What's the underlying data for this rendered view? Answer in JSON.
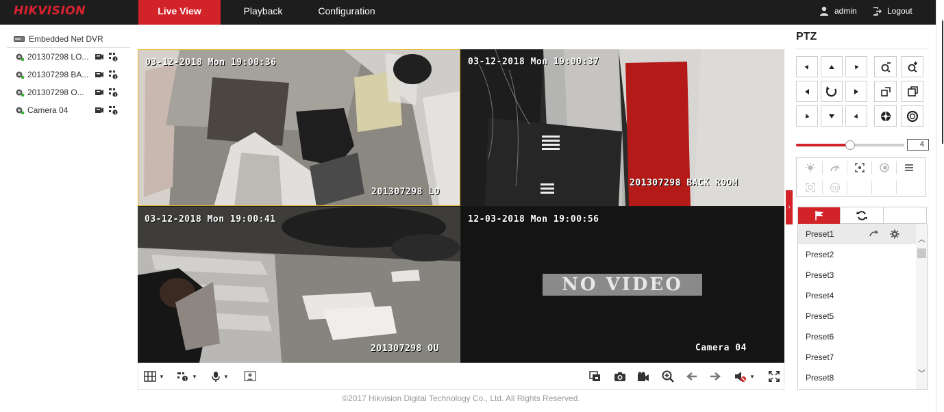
{
  "brand": {
    "logo": "HIKVISION",
    "accent": "#d22328",
    "topbar_bg": "#1d1d1d"
  },
  "nav": {
    "tabs": [
      {
        "label": "Live View",
        "active": true
      },
      {
        "label": "Playback",
        "active": false
      },
      {
        "label": "Configuration",
        "active": false
      }
    ],
    "user": "admin",
    "logout": "Logout"
  },
  "tree": {
    "root": "Embedded Net DVR",
    "cameras": [
      {
        "label": "201307298 LO..."
      },
      {
        "label": "201307298 BA..."
      },
      {
        "label": "201307298 O..."
      },
      {
        "label": "Camera 04"
      }
    ]
  },
  "panes": [
    {
      "time": "03-12-2018 Mon 19:00:36",
      "name": "201307298 LO",
      "selected": true
    },
    {
      "time": "03-12-2018 Mon 19:00:37",
      "name": "201307298 BACK ROOM",
      "selected": false
    },
    {
      "time": "03-12-2018 Mon 19:00:41",
      "name": "201307298 OU",
      "selected": false
    },
    {
      "time": "12-03-2018 Mon 19:00:56",
      "name": "Camera 04",
      "status": "NO VIDEO",
      "selected": false
    }
  ],
  "footer": "©2017 Hikvision Digital Technology Co., Ltd. All Rights Reserved.",
  "ptz": {
    "title": "PTZ",
    "speed": 4,
    "speed_max": 7,
    "presets": [
      "Preset1",
      "Preset2",
      "Preset3",
      "Preset4",
      "Preset5",
      "Preset6",
      "Preset7",
      "Preset8"
    ]
  }
}
